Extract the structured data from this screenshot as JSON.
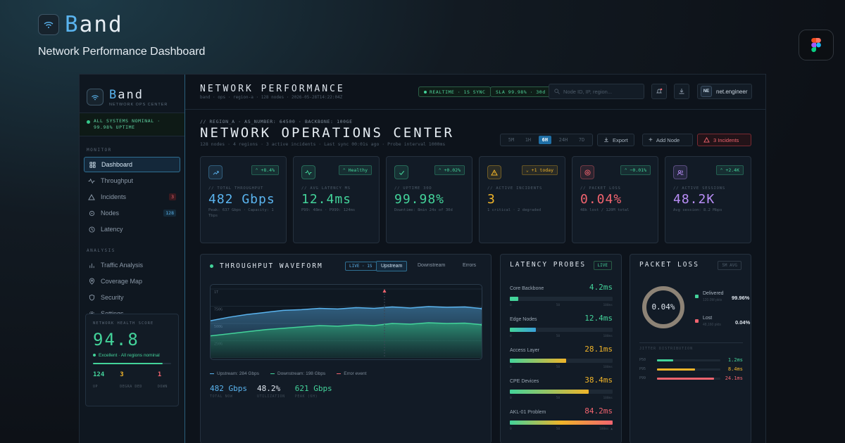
{
  "brand": {
    "first_letter": "B",
    "rest": "and"
  },
  "subtitle": "Network Performance Dashboard",
  "sidebar": {
    "brand_first": "B",
    "brand_rest": "and",
    "tagline": "NETWORK OPS CENTER",
    "status": "ALL SYSTEMS NOMINAL · 99.98% UPTIME",
    "sections": {
      "monitor": "MONITOR",
      "analysis": "ANALYSIS"
    },
    "monitor_items": [
      {
        "label": "Dashboard",
        "icon": "grid-icon"
      },
      {
        "label": "Throughput",
        "icon": "activity-icon"
      },
      {
        "label": "Incidents",
        "icon": "warning-icon",
        "badge": "3"
      },
      {
        "label": "Nodes",
        "icon": "nodes-icon",
        "badge": "128"
      },
      {
        "label": "Latency",
        "icon": "clock-icon"
      }
    ],
    "analysis_items": [
      {
        "label": "Traffic Analysis",
        "icon": "bar-chart-icon"
      },
      {
        "label": "Coverage Map",
        "icon": "map-pin-icon"
      },
      {
        "label": "Security",
        "icon": "shield-icon"
      },
      {
        "label": "Settings",
        "icon": "gear-icon"
      }
    ],
    "health": {
      "label": "NETWORK HEALTH SCORE",
      "score": "94.8",
      "desc": "Excellent · All regions nominal",
      "fill_fraction": 0.89,
      "stats": [
        {
          "value": "124",
          "label": "UP",
          "color": "#43d39a"
        },
        {
          "value": "3",
          "label": "DEGRA DED",
          "color": "#f0b429"
        },
        {
          "value": "1",
          "label": "DOWN",
          "color": "#f2646f"
        }
      ]
    }
  },
  "topbar": {
    "title": "NETWORK PERFORMANCE",
    "sub": "band · ops · region-a · 128 nodes · 2026-05-28T14:22:04Z",
    "realtime": "REALTIME · 1S SYNC",
    "sla": "SLA 99.98% · 30d",
    "search_placeholder": "Node ID, IP, region...",
    "user_initials": "NE",
    "user_name": "net.engineer"
  },
  "main_header": {
    "crumb": "// REGION_A · AS_NUMBER: 64500 · BACKBONE: 100GE",
    "title": "NETWORK OPERATIONS CENTER",
    "sub": "128 nodes · 4 regions · 3 active incidents · Last sync 00:01s ago · Probe interval 1000ms",
    "ranges": [
      "5M",
      "1H",
      "6H",
      "24H",
      "7D"
    ],
    "active_range": "6H",
    "export": "Export",
    "add_node": "Add Node",
    "incidents": "3 Incidents"
  },
  "kpis": [
    {
      "label": "// TOTAL THROUGHPUT",
      "value": "482 Gbps",
      "change": "⌃ +8.4%",
      "sub": "Peak: 637 Gbps · Capacity: 1 Tbps",
      "color": "#5ab4ef",
      "icon": "trending-up-icon",
      "chg_color": "#43d39a"
    },
    {
      "label": "// AVG LATENCY MS",
      "value": "12.4ms",
      "change": "⌃ Healthy",
      "sub": "P99: 48ms · P999: 124ms",
      "color": "#43d39a",
      "icon": "pulse-icon",
      "chg_color": "#43d39a"
    },
    {
      "label": "// UPTIME 30D",
      "value": "99.98%",
      "change": "⌃ +0.02%",
      "sub": "Downtime: 8min 24s of 30d",
      "color": "#43d39a",
      "icon": "check-icon",
      "chg_color": "#43d39a"
    },
    {
      "label": "// ACTIVE INCIDENTS",
      "value": "3",
      "change": "⌄ +1 today",
      "sub": "1 critical · 2 degraded",
      "color": "#f0b429",
      "icon": "warning-icon",
      "chg_color": "#f0b429"
    },
    {
      "label": "// PACKET LOSS",
      "value": "0.04%",
      "change": "⌃ −0.01%",
      "sub": "48k lost / 120M total",
      "color": "#f2646f",
      "icon": "target-icon",
      "chg_color": "#43d39a"
    },
    {
      "label": "// ACTIVE SESSIONS",
      "value": "48.2K",
      "change": "⌃ +2.4K",
      "sub": "Avg session: 8.2 Mbps",
      "color": "#b98ef7",
      "icon": "users-icon",
      "chg_color": "#43d39a"
    }
  ],
  "waveform": {
    "title": "THROUGHPUT WAVEFORM",
    "live": "LIVE · 1S",
    "segments": [
      "Upstream",
      "Downstream",
      "Errors"
    ],
    "active_segment": "Upstream",
    "y_ticks": [
      "1T",
      "750G",
      "500G",
      "250G",
      "0"
    ],
    "legend": [
      {
        "label": "Upstream: 284 Gbps",
        "color": "#5ab4ef"
      },
      {
        "label": "Downstream: 198 Gbps",
        "color": "#43d39a"
      },
      {
        "label": "Error event",
        "color": "#f2646f"
      }
    ],
    "stats": [
      {
        "value": "482 Gbps",
        "label": "TOTAL NOW",
        "color": "#5ab4ef"
      },
      {
        "value": "48.2%",
        "label": "UTILIZATION",
        "color": "#dfe6ee"
      },
      {
        "value": "621 Gbps",
        "label": "PEAK (6H)",
        "color": "#43d39a"
      }
    ]
  },
  "chart_data": {
    "type": "area",
    "ylim": [
      0,
      1000
    ],
    "series": [
      {
        "name": "Upstream",
        "values": [
          540,
          590,
          630,
          660,
          690,
          700,
          720,
          710,
          730,
          720,
          740,
          725,
          745,
          735,
          740,
          715
        ]
      },
      {
        "name": "Downstream",
        "values": [
          320,
          350,
          380,
          410,
          430,
          450,
          470,
          460,
          480,
          470,
          500,
          490,
          510,
          500,
          505,
          480
        ]
      }
    ]
  },
  "latency": {
    "title": "LATENCY PROBES",
    "live": "LIVE",
    "probes": [
      {
        "name": "Core Backbone",
        "value": "4.2ms",
        "fill": 0.05,
        "color": "#43d39a",
        "grad": "#43d39a"
      },
      {
        "name": "Edge Nodes",
        "value": "12.4ms",
        "fill": 0.25,
        "color": "#43d39a",
        "grad": "#3aa0d8"
      },
      {
        "name": "Access Layer",
        "value": "28.1ms",
        "fill": 0.55,
        "color": "#f0b429",
        "grad": "#f0b429"
      },
      {
        "name": "CPE Devices",
        "value": "38.4ms",
        "fill": 0.77,
        "color": "#f0b429",
        "grad": "#f0b429"
      },
      {
        "name": "AKL-01 Problem",
        "value": "84.2ms",
        "fill": 1.0,
        "color": "#f2646f",
        "grad": "#f2646f"
      }
    ],
    "ticks": [
      "0",
      "50",
      "100ms"
    ],
    "last_tick": "100ms ▲"
  },
  "packet_loss": {
    "title": "PACKET LOSS",
    "tag": "5M AVG",
    "center": "0.04%",
    "delivered_label": "Delivered",
    "delivered_sub": "120.0M pkts",
    "delivered_pct": "99.96%",
    "lost_label": "Lost",
    "lost_sub": "48,160 pkts",
    "lost_pct": "0.04%",
    "jitter_title": "JITTER DISTRIBUTION",
    "jitter": [
      {
        "label": "P50",
        "value": "1.2ms",
        "fill": 0.25,
        "color": "#43d39a"
      },
      {
        "label": "P95",
        "value": "8.4ms",
        "fill": 0.6,
        "color": "#f0b429"
      },
      {
        "label": "P99",
        "value": "24.1ms",
        "fill": 0.9,
        "color": "#f2646f"
      }
    ]
  }
}
